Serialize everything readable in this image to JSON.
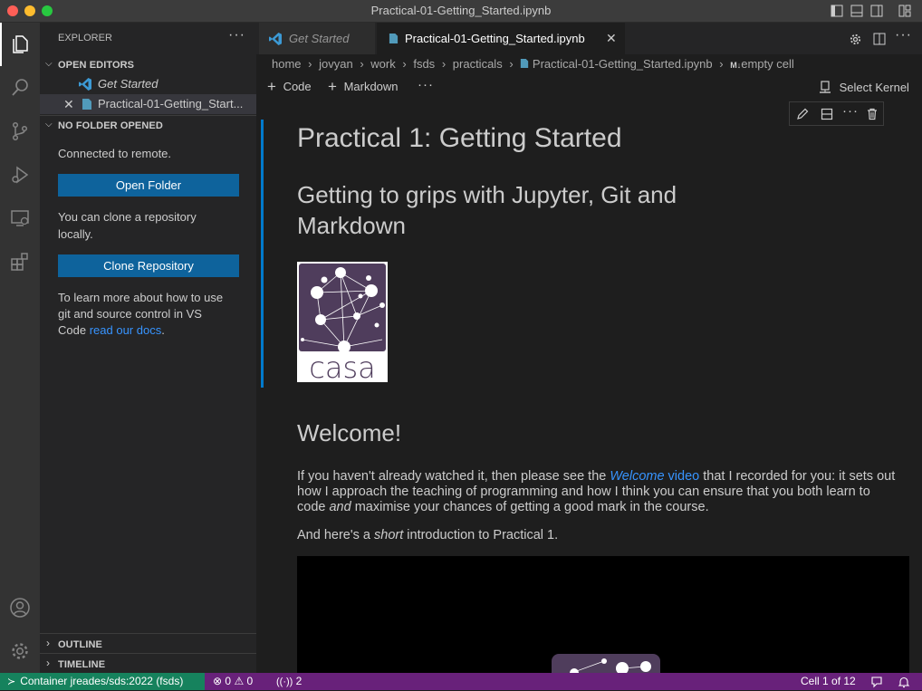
{
  "window": {
    "title": "Practical-01-Getting_Started.ipynb"
  },
  "sidebar": {
    "header": "EXPLORER",
    "open_editors": {
      "title": "OPEN EDITORS",
      "items": [
        {
          "label": "Get Started"
        },
        {
          "label": "Practical-01-Getting_Start..."
        }
      ]
    },
    "no_folder": {
      "title": "NO FOLDER OPENED",
      "connected": "Connected to remote.",
      "open_folder": "Open Folder",
      "clone_line1": "You can clone a repository",
      "clone_line2": "locally.",
      "clone_button": "Clone Repository",
      "learn_line1": "To learn more about how to use",
      "learn_line2": "git and source control in VS",
      "learn_prefix": "Code ",
      "learn_link": "read our docs",
      "learn_suffix": "."
    },
    "outline": "OUTLINE",
    "timeline": "TIMELINE"
  },
  "tabs": [
    {
      "label": "Get Started"
    },
    {
      "label": "Practical-01-Getting_Started.ipynb"
    }
  ],
  "breadcrumb": [
    "home",
    "jovyan",
    "work",
    "fsds",
    "practicals",
    "Practical-01-Getting_Started.ipynb",
    "empty cell"
  ],
  "breadcrumb_md_badge": "M↓",
  "toolbar": {
    "code": "Code",
    "markdown": "Markdown",
    "select_kernel": "Select Kernel"
  },
  "cell": {
    "h1": "Practical 1: Getting Started",
    "h2_line1": "Getting to grips with Jupyter, Git and",
    "h2_line2": "Markdown",
    "logo_text": "casa",
    "welcome": "Welcome!",
    "p1_a": "If you haven't already watched it, then please see the ",
    "p1_link_em": "Welcome",
    "p1_link": " video",
    "p1_b": " that I recorded for you: it sets out",
    "p1_line2": "how I approach the teaching of programming and how I think you can ensure that you both learn to",
    "p1_line3_a": "code ",
    "p1_line3_em": "and",
    "p1_line3_b": " maximise your chances of getting a good mark in the course.",
    "p2_a": "And here's a ",
    "p2_em": "short",
    "p2_b": " introduction to Practical 1."
  },
  "status": {
    "remote": "Container jreades/sds:2022 (fsds)",
    "errors": "0",
    "warnings": "0",
    "ports": "2",
    "cell_position": "Cell 1 of 12"
  },
  "colors": {
    "accent": "#007acc",
    "status_bar": "#68217a",
    "remote": "#16825d",
    "button": "#0e639c",
    "link": "#3794ff",
    "logo_bg": "#4f3d5c"
  }
}
